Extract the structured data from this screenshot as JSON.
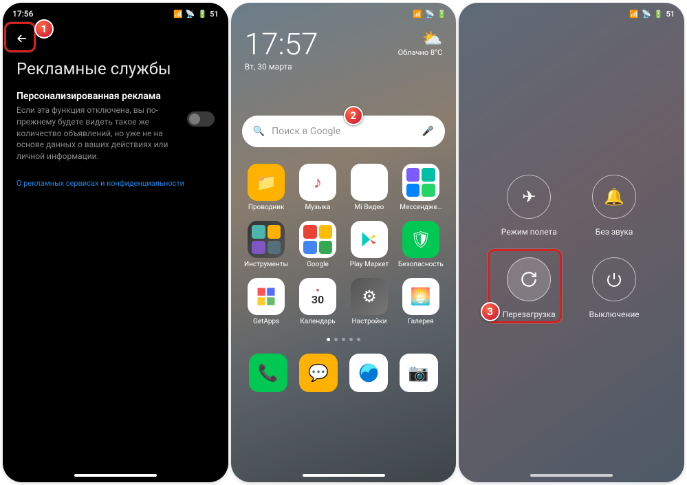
{
  "screen1": {
    "status_time": "17:56",
    "battery": "51",
    "title": "Рекламные службы",
    "setting_title": "Персонализированная реклама",
    "setting_desc": "Если эта функция отключена, вы по-прежнему будете видеть такое же количество объявлений, но уже не на основе данных о ваших действиях или личной информации.",
    "link_text": "О рекламных сервисах и конфиденциальности"
  },
  "screen2": {
    "clock": "17:57",
    "date": "Вт, 30 марта",
    "weather_text": "Облачно 8°C",
    "search_placeholder": "Поиск в Google",
    "apps": [
      {
        "label": "Проводник",
        "name": "file-manager"
      },
      {
        "label": "Музыка",
        "name": "music"
      },
      {
        "label": "Mi Видео",
        "name": "mi-video"
      },
      {
        "label": "Мессендже…",
        "name": "messenger"
      },
      {
        "label": "Инструменты",
        "name": "tools-folder"
      },
      {
        "label": "Google",
        "name": "google-folder"
      },
      {
        "label": "Play Маркет",
        "name": "play-store"
      },
      {
        "label": "Безопасность",
        "name": "security"
      },
      {
        "label": "GetApps",
        "name": "getapps"
      },
      {
        "label": "Календарь",
        "name": "calendar"
      },
      {
        "label": "Настройки",
        "name": "settings"
      },
      {
        "label": "Галерея",
        "name": "gallery"
      }
    ],
    "calendar_day": "30",
    "dock": [
      {
        "name": "phone"
      },
      {
        "name": "messages"
      },
      {
        "name": "browser"
      },
      {
        "name": "camera"
      }
    ]
  },
  "screen3": {
    "battery": "51",
    "items": [
      {
        "label": "Режим полета",
        "name": "airplane-mode"
      },
      {
        "label": "Без звука",
        "name": "silent"
      },
      {
        "label": "Перезагрузка",
        "name": "reboot"
      },
      {
        "label": "Выключение",
        "name": "power-off"
      }
    ]
  },
  "callouts": {
    "n1": "1",
    "n2": "2",
    "n3": "3"
  }
}
